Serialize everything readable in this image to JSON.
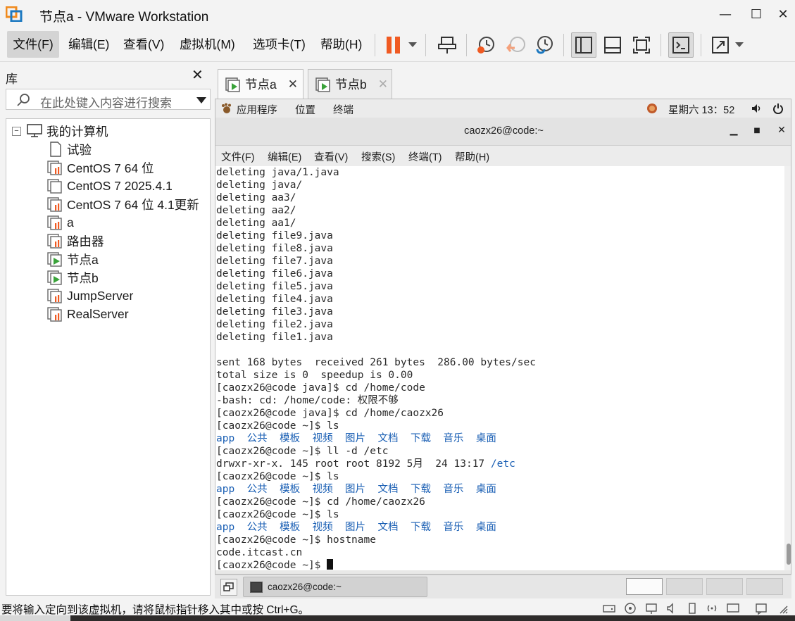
{
  "window": {
    "title": "节点a - VMware Workstation",
    "minimize": "—",
    "maximize": "☐",
    "close": "✕"
  },
  "menu": {
    "file": "文件(F)",
    "edit": "编辑(E)",
    "view": "查看(V)",
    "vm": "虚拟机(M)",
    "tabs": "选项卡(T)",
    "help": "帮助(H)"
  },
  "library": {
    "title": "库",
    "close": "✕",
    "search_placeholder": "在此处键入内容进行搜索",
    "root": "我的计算机",
    "items": [
      {
        "label": "试验",
        "icon": "vm-doc-icon"
      },
      {
        "label": "CentOS 7 64 位",
        "icon": "vm-icon"
      },
      {
        "label": "CentOS 7 2025.4.1",
        "icon": "vm-icon-plain"
      },
      {
        "label": "CentOS 7 64 位 4.1更新",
        "icon": "vm-icon"
      },
      {
        "label": "a",
        "icon": "vm-icon"
      },
      {
        "label": "路由器",
        "icon": "vm-icon"
      },
      {
        "label": "节点a",
        "icon": "vm-running-icon"
      },
      {
        "label": "节点b",
        "icon": "vm-running-icon"
      },
      {
        "label": "JumpServer",
        "icon": "vm-icon"
      },
      {
        "label": "RealServer",
        "icon": "vm-icon"
      }
    ]
  },
  "tabs": [
    {
      "label": "节点a",
      "close": "✕",
      "active": true
    },
    {
      "label": "节点b",
      "close": "✕",
      "active": false
    }
  ],
  "gnome": {
    "apps": "应用程序",
    "places": "位置",
    "terminal": "终端",
    "clock": "星期六 13：52"
  },
  "terminal": {
    "title": "caozx26@code:~",
    "menu": {
      "file": "文件(F)",
      "edit": "编辑(E)",
      "view": "查看(V)",
      "search": "搜索(S)",
      "terminal": "终端(T)",
      "help": "帮助(H)"
    },
    "lines": [
      "deleting java/1.java",
      "deleting java/",
      "deleting aa3/",
      "deleting aa2/",
      "deleting aa1/",
      "deleting file9.java",
      "deleting file8.java",
      "deleting file7.java",
      "deleting file6.java",
      "deleting file5.java",
      "deleting file4.java",
      "deleting file3.java",
      "deleting file2.java",
      "deleting file1.java",
      "",
      "sent 168 bytes  received 261 bytes  286.00 bytes/sec",
      "total size is 0  speedup is 0.00",
      "[caozx26@code java]$ cd /home/code",
      "-bash: cd: /home/code: 权限不够",
      "[caozx26@code java]$ cd /home/caozx26",
      "[caozx26@code ~]$ ls",
      "LS_OUTPUT_1",
      "[caozx26@code ~]$ ll -d /etc",
      "ETC_LINE",
      "[caozx26@code ~]$ ls",
      "LS_OUTPUT_2",
      "[caozx26@code ~]$ cd /home/caozx26",
      "[caozx26@code ~]$ ls",
      "LS_OUTPUT_3",
      "[caozx26@code ~]$ hostname",
      "code.itcast.cn",
      "PROMPT_CURSOR"
    ],
    "ls_output": "app  公共  模板  视频  图片  文档  下载  音乐  桌面",
    "etc_prefix": "drwxr-xr-x. 145 root root 8192 5月  24 13:17 ",
    "etc_dir": "/etc",
    "final_prompt": "[caozx26@code ~]$ "
  },
  "taskbar": {
    "task_label": "caozx26@code:~"
  },
  "status": {
    "text": "要将输入定向到该虚拟机，请将鼠标指针移入其中或按 Ctrl+G。"
  },
  "colors": {
    "accent_orange": "#f05a22",
    "play_green": "#3aa33a",
    "link_blue": "#1a5fb4",
    "highlight_red": "#e8181c"
  }
}
